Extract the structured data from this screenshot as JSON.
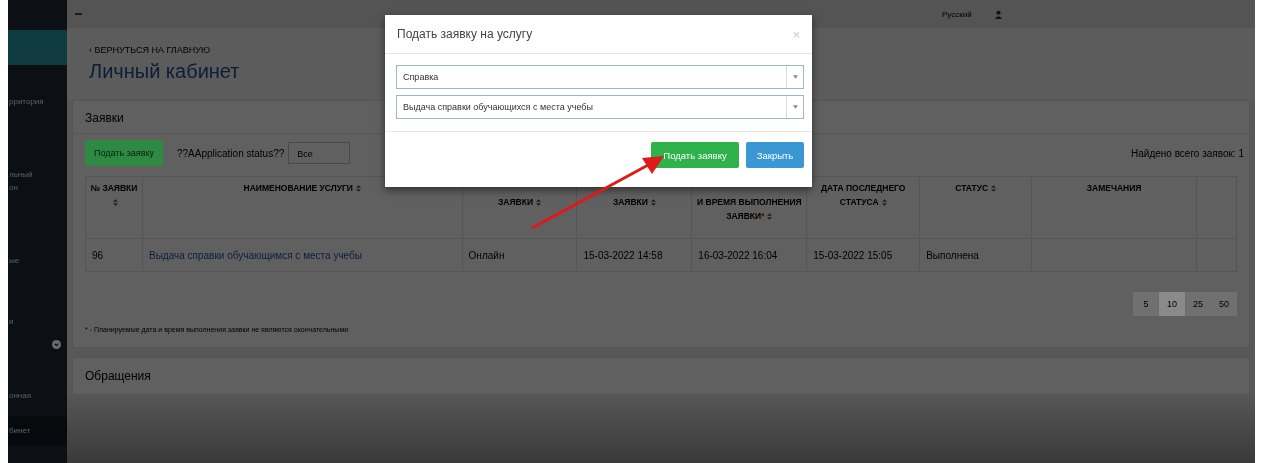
{
  "sidebar": {
    "items": [
      {
        "label": "рритория",
        "selected": false
      },
      {
        "label": "льный\nон",
        "selected": false
      },
      {
        "label": "ые",
        "selected": false
      },
      {
        "label": "и",
        "selected": false
      },
      {
        "label": "онная",
        "selected": false
      },
      {
        "label": "бинет",
        "selected": true
      }
    ]
  },
  "top_bar": {
    "language": "Русский"
  },
  "header": {
    "back_link": "‹ ВЕРНУТЬСЯ НА ГЛАВНУЮ",
    "title": "Личный кабинет"
  },
  "requests_panel": {
    "title": "Заявки",
    "submit_button": "Подать заявку",
    "status_label": "??AApplication status??",
    "status_value": "Все",
    "found_text": "Найдено всего заявок: 1",
    "table": {
      "columns": [
        {
          "label": "№ ЗАЯВКИ",
          "sortable": true,
          "covered": false
        },
        {
          "label": "НАИМЕНОВАНИЕ УСЛУГИ",
          "sortable": true,
          "covered": false
        },
        {
          "label": "ЗАЯВКИ",
          "sortable": true,
          "covered": true
        },
        {
          "label": "ЗАЯВКИ",
          "sortable": true,
          "covered": true
        },
        {
          "label": "И ВРЕМЯ ВЫПОЛНЕНИЯ ЗАЯВКИ",
          "sortable": true,
          "covered": true,
          "note_mark": "*"
        },
        {
          "label": "ДАТА ПОСЛЕДНЕГО СТАТУСА",
          "sortable": true,
          "covered": false
        },
        {
          "label": "СТАТУС",
          "sortable": true,
          "covered": false
        },
        {
          "label": "ЗАМЕЧАНИЯ",
          "sortable": false,
          "covered": false
        }
      ],
      "rows": [
        {
          "cells": [
            "96",
            "Выдача справки обучающимся с места учебы",
            "Онлайн",
            "15-03-2022 14:58",
            "16-03-2022 16:04",
            "15-03-2022 15:05",
            "Выполнена"
          ]
        }
      ]
    },
    "page_sizes": [
      {
        "label": "5",
        "selected": false
      },
      {
        "label": "10",
        "selected": true
      },
      {
        "label": "25",
        "selected": false
      },
      {
        "label": "50",
        "selected": false
      }
    ],
    "footnote": "* - Планируемые дата и время выполнения заявки не являются окончательными"
  },
  "appeals_panel": {
    "title": "Обращения"
  },
  "modal": {
    "title": "Подать заявку на услугу",
    "close": "×",
    "selects": [
      "Справка",
      "Выдача справки обучающихся с места учебы"
    ],
    "submit_button": "Подать заявку",
    "close_button": "Закрыть"
  }
}
